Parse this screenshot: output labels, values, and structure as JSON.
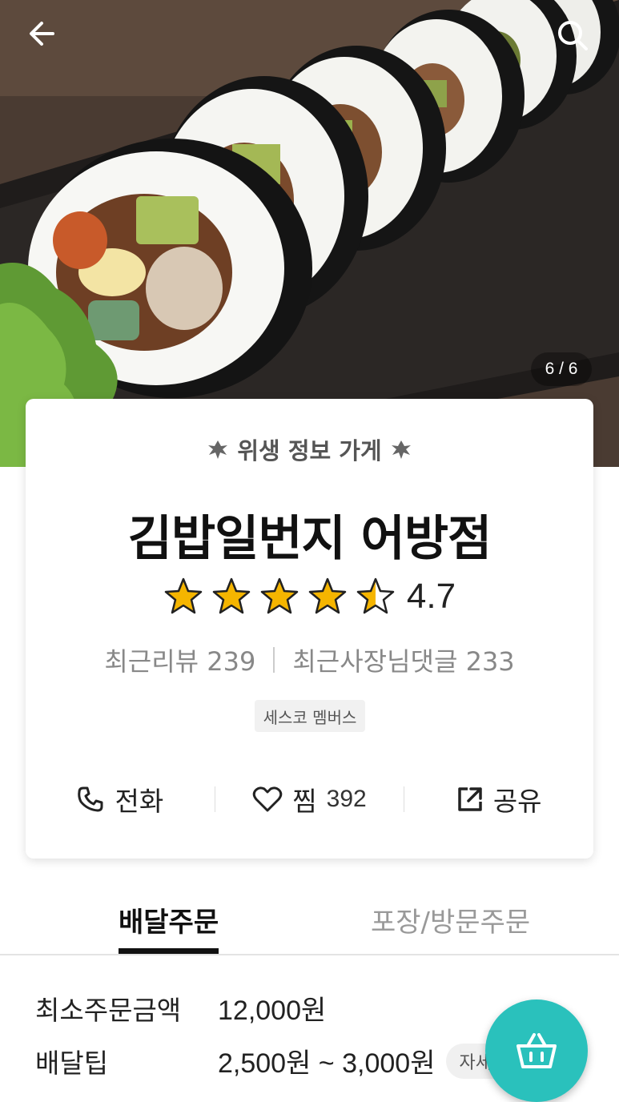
{
  "header": {
    "back_icon": "arrow-left-icon",
    "search_icon": "search-icon",
    "photo_counter": "6 / 6"
  },
  "store": {
    "hygiene_label": "위생 정보 가게",
    "name": "김밥일번지 어방점",
    "rating": 4.7,
    "rating_text": "4.7",
    "stars_filled": 4.5,
    "recent_reviews": "최근리뷰 239",
    "owner_replies": "최근사장님댓글 233",
    "badge": "세스코 멤버스"
  },
  "actions": {
    "call_label": "전화",
    "favorite_label": "찜",
    "favorite_count": "392",
    "share_label": "공유"
  },
  "tabs": [
    {
      "label": "배달주문",
      "active": true
    },
    {
      "label": "포장/방문주문",
      "active": false
    }
  ],
  "delivery": {
    "min_order_label": "최소주문금액",
    "min_order_value": "12,000원",
    "tip_label": "배달팁",
    "tip_value": "2,500원 ~ 3,000원",
    "detail_label": "자세히"
  },
  "colors": {
    "accent": "#2ac1bc",
    "star": "#f5b500"
  }
}
